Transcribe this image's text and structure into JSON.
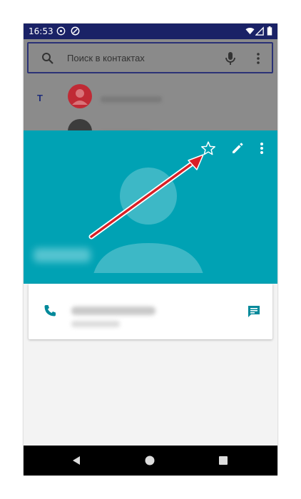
{
  "status_bar": {
    "time": "16:53",
    "icons": [
      "notification-badge-icon",
      "vpn-icon",
      "wifi-icon",
      "signal-icon",
      "battery-icon"
    ]
  },
  "contacts_list": {
    "search_placeholder": "Поиск в контактах",
    "section_letter": "Т"
  },
  "contact_card": {
    "actions": [
      "star-outline-icon",
      "edit-pencil-icon",
      "more-vert-icon"
    ],
    "phone_row_icons": [
      "phone-icon",
      "message-icon"
    ]
  },
  "nav_bar": {
    "buttons": [
      "back-icon",
      "home-icon",
      "recents-icon"
    ]
  },
  "colors": {
    "status_bar": "#1a2266",
    "header": "#00a2b4",
    "accent": "#00899a",
    "annotation": "#d81f26"
  }
}
